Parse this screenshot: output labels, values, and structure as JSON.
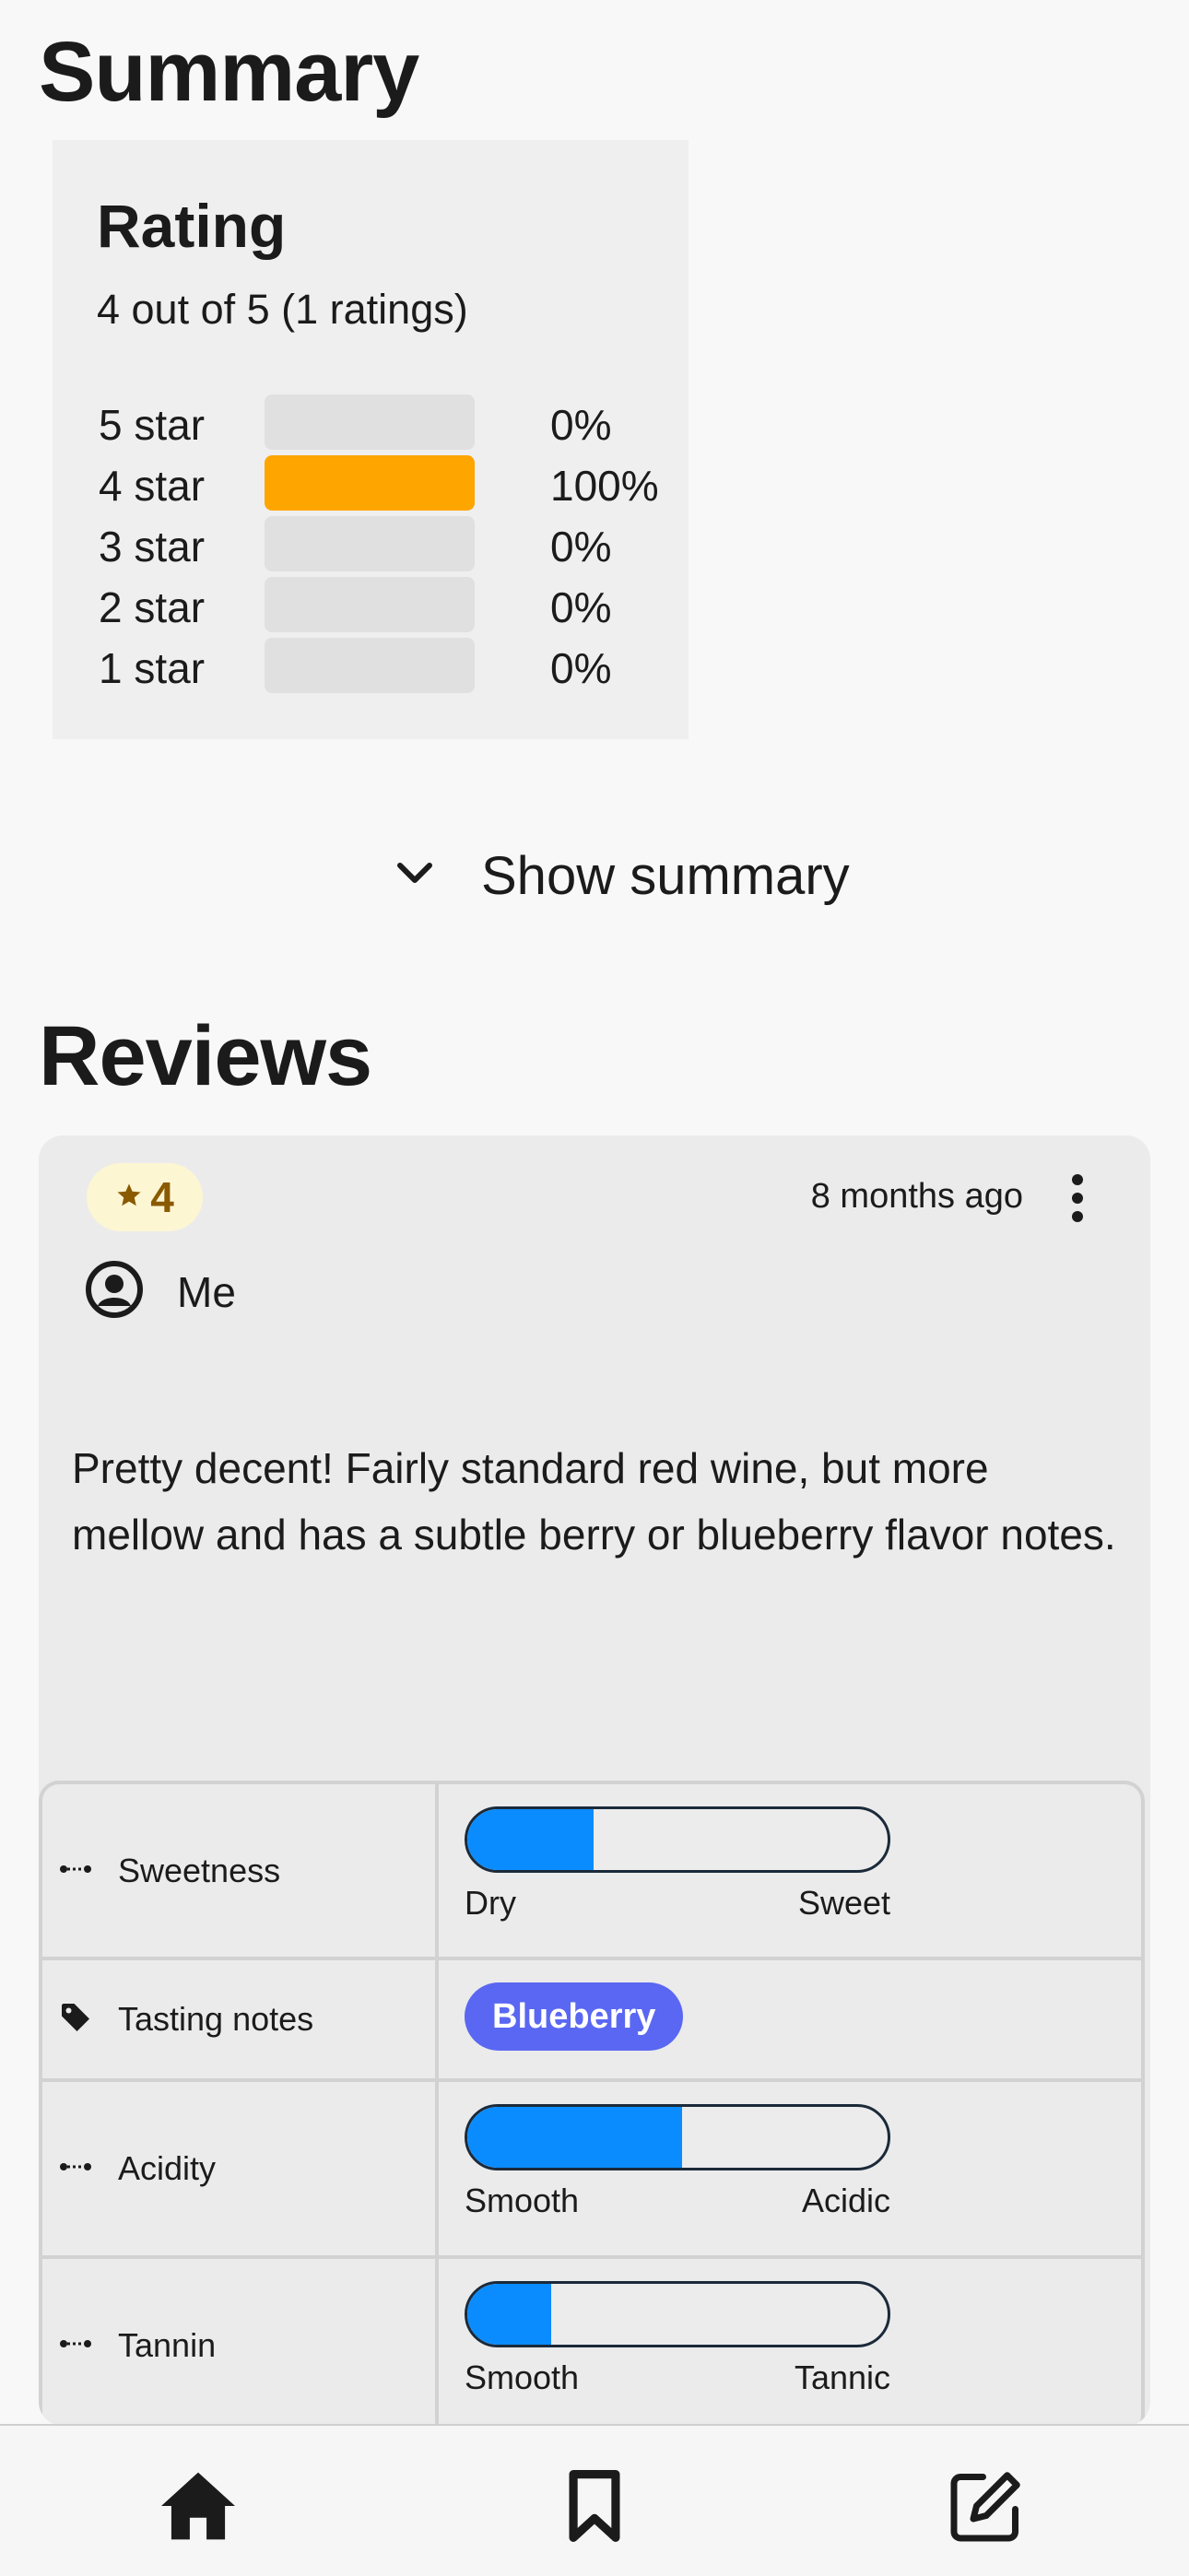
{
  "summary": {
    "title": "Summary",
    "rating": {
      "title": "Rating",
      "subtitle": "4 out of 5 (1 ratings)",
      "distribution": [
        {
          "label": "5 star",
          "percent": 0,
          "percent_label": "0%"
        },
        {
          "label": "4 star",
          "percent": 100,
          "percent_label": "100%"
        },
        {
          "label": "3 star",
          "percent": 0,
          "percent_label": "0%"
        },
        {
          "label": "2 star",
          "percent": 0,
          "percent_label": "0%"
        },
        {
          "label": "1 star",
          "percent": 0,
          "percent_label": "0%"
        }
      ]
    },
    "toggle_label": "Show summary"
  },
  "reviews": {
    "title": "Reviews",
    "items": [
      {
        "stars": "4",
        "time_ago": "8 months ago",
        "author": "Me",
        "text": "Pretty decent! Fairly standard red wine, but more mellow and has a subtle berry or blueberry flavor notes.",
        "attributes": [
          {
            "name": "Sweetness",
            "icon": "dots-icon",
            "type": "scale",
            "level": 0.3,
            "low": "Dry",
            "high": "Sweet"
          },
          {
            "name": "Tasting notes",
            "icon": "tag-icon",
            "type": "tags",
            "tags": [
              "Blueberry"
            ]
          },
          {
            "name": "Acidity",
            "icon": "dots-icon",
            "type": "scale",
            "level": 0.51,
            "low": "Smooth",
            "high": "Acidic"
          },
          {
            "name": "Tannin",
            "icon": "dots-icon",
            "type": "scale",
            "level": 0.2,
            "low": "Smooth",
            "high": "Tannic"
          }
        ]
      }
    ]
  },
  "colors": {
    "rating_fill": "#ffa500",
    "scale_fill": "#0a8cff",
    "tag_bg": "#5a67f2",
    "badge_bg": "#fdf6d3"
  },
  "bottom_nav": [
    {
      "name": "home",
      "icon": "home-icon"
    },
    {
      "name": "bookmarks",
      "icon": "bookmark-icon"
    },
    {
      "name": "write",
      "icon": "edit-icon"
    }
  ]
}
